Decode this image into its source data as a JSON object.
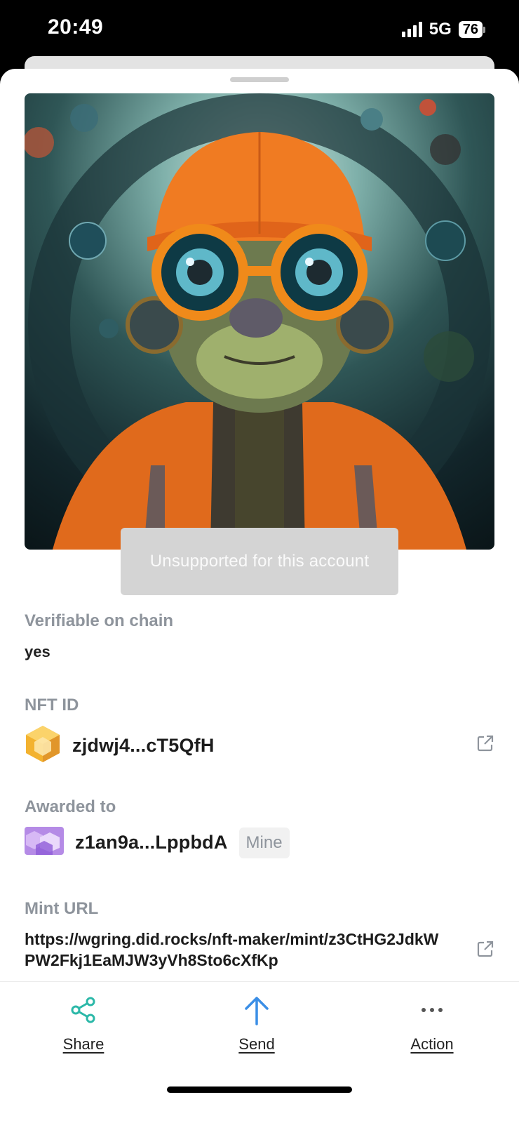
{
  "status_bar": {
    "time": "20:49",
    "network": "5G",
    "battery": "76"
  },
  "toast": {
    "message": "Unsupported for this account"
  },
  "verifiable": {
    "label": "Verifiable on chain",
    "value": "yes"
  },
  "nft_id": {
    "label": "NFT ID",
    "value": "zjdwj4...cT5QfH",
    "icon": "nft-hexagon-icon"
  },
  "awarded_to": {
    "label": "Awarded to",
    "value": "z1an9a...LppbdA",
    "badge": "Mine",
    "icon": "wallet-avatar-icon"
  },
  "mint_url": {
    "label": "Mint URL",
    "value": "https://wgring.did.rocks/nft-maker/mint/z3CtHG2JdkWPW2Fkj1EaMJW3yVh8Sto6cXfKp"
  },
  "actions": [
    {
      "label": "Share",
      "icon": "share-icon",
      "color": "#2bb8a8"
    },
    {
      "label": "Send",
      "icon": "arrow-up-icon",
      "color": "#3a8ee6"
    },
    {
      "label": "Action",
      "icon": "more-dots-icon",
      "color": "#555555"
    }
  ]
}
